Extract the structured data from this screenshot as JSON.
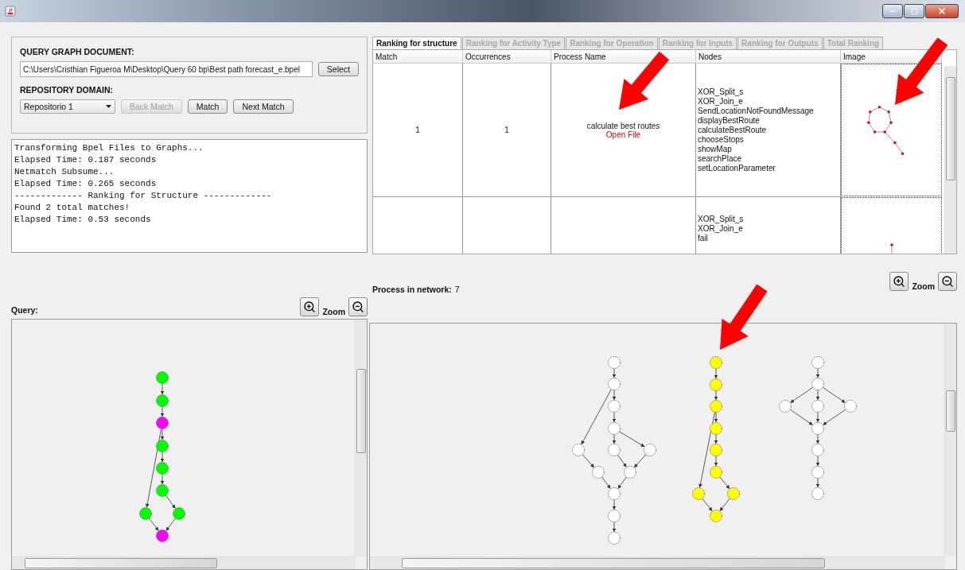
{
  "query_form": {
    "document_label": "QUERY GRAPH DOCUMENT:",
    "document_path": "C:\\Users\\Cristhian Figueroa M\\Desktop\\Query 60 bp\\Best path forecast_e.bpel",
    "select_button": "Select",
    "domain_label": "REPOSITORY DOMAIN:",
    "domain_value": "Repositorio 1",
    "buttons": [
      {
        "label": "Back Match",
        "disabled": true
      },
      {
        "label": "Match",
        "disabled": false
      },
      {
        "label": "Next Match",
        "disabled": false
      }
    ]
  },
  "log": [
    "Transforming Bpel Files to Graphs...",
    "Elapsed Time: 0.187 seconds",
    "Netmatch Subsume...",
    "Elapsed Time: 0.265 seconds",
    "------------- Ranking for Structure -------------",
    "Found 2 total matches!",
    "Elapsed Time: 0.53 seconds"
  ],
  "tabs": [
    {
      "label": "Ranking for structure",
      "selected": true
    },
    {
      "label": "Ranking for Activity Type",
      "selected": false
    },
    {
      "label": "Ranking for Operation",
      "selected": false
    },
    {
      "label": "Ranking for Inputs",
      "selected": false
    },
    {
      "label": "Ranking for Outputs",
      "selected": false
    },
    {
      "label": "Total Ranking",
      "selected": false
    }
  ],
  "table": {
    "columns": [
      "Match",
      "Occurrences",
      "Process Name",
      "Nodes",
      "Image"
    ],
    "rows": [
      {
        "match": "1",
        "occurrences": "1",
        "process_name": "calculate best routes",
        "link": "Open File",
        "nodes": [
          "XOR_Split_s",
          "XOR_Join_e",
          "SendLocationNotFoundMessage",
          "displayBestRoute",
          "calculateBestRoute",
          "chooseStops",
          "showMap",
          "searchPlace",
          "setLocationParameter"
        ],
        "thumbnail": {
          "kind": "ring"
        }
      },
      {
        "nodes": [
          "XOR_Split_s",
          "XOR_Join_e",
          "fail"
        ],
        "thumbnail": {
          "kind": "stub"
        }
      }
    ]
  },
  "network": {
    "label": "Process in network:",
    "count": "7",
    "zoom_label": "Zoom",
    "processes": [
      {
        "nodes": [
          {
            "color": "#ffffff"
          },
          {
            "color": "#ffffff"
          },
          {
            "color": "#ffffff"
          },
          {
            "color": "#ffffff"
          },
          {
            "color": "#ffffff"
          },
          {
            "color": "#ffffff"
          },
          {
            "color": "#ffffff"
          },
          {
            "color": "#ffffff"
          },
          {
            "color": "#ffffff"
          },
          {
            "color": "#ffffff"
          },
          {
            "color": "#ffffff"
          },
          {
            "color": "#ffffff"
          }
        ]
      },
      {
        "nodes": [
          {
            "color": "#ffff00"
          },
          {
            "color": "#ffff00"
          },
          {
            "color": "#ffff00"
          },
          {
            "color": "#ffff00"
          },
          {
            "color": "#ffff00"
          },
          {
            "color": "#ffff00"
          },
          {
            "color": "#ffff00"
          },
          {
            "color": "#ffff00"
          },
          {
            "color": "#ffff00"
          }
        ]
      },
      {
        "nodes": [
          {
            "color": "#ffffff"
          },
          {
            "color": "#ffffff"
          },
          {
            "color": "#ffffff"
          },
          {
            "color": "#ffffff"
          },
          {
            "color": "#ffffff"
          },
          {
            "color": "#ffffff"
          },
          {
            "color": "#ffffff"
          },
          {
            "color": "#ffffff"
          },
          {
            "color": "#ffffff"
          }
        ]
      }
    ]
  },
  "query_graph": {
    "label": "Query:",
    "zoom_label": "Zoom",
    "nodes": [
      {
        "color": "#00ff00"
      },
      {
        "color": "#00ff00"
      },
      {
        "color": "#ff00ff"
      },
      {
        "color": "#00ff00"
      },
      {
        "color": "#00ff00"
      },
      {
        "color": "#00ff00"
      },
      {
        "color": "#00ff00"
      },
      {
        "color": "#00ff00"
      },
      {
        "color": "#ff00ff"
      }
    ]
  },
  "annotations": [
    {
      "kind": "arrow"
    },
    {
      "kind": "arrow"
    },
    {
      "kind": "arrow"
    }
  ]
}
